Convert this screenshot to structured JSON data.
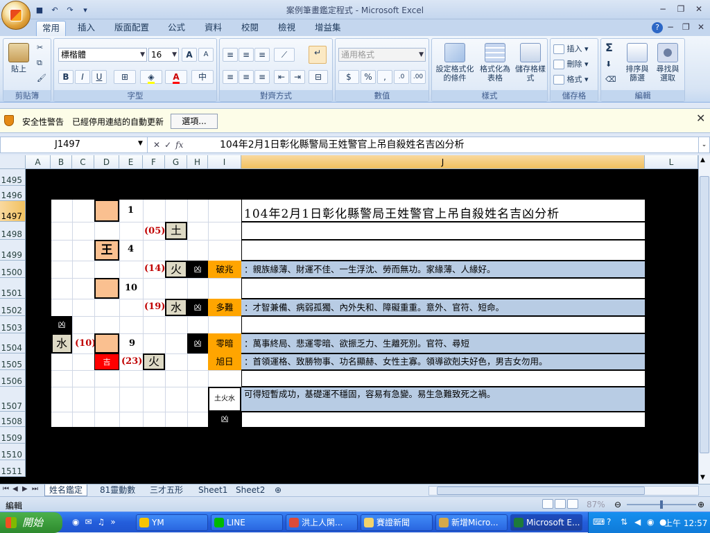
{
  "window": {
    "title": "案例筆畫鑑定程式 - Microsoft Excel",
    "min": "−",
    "restore": "❐",
    "close": "✕"
  },
  "tabs": [
    "常用",
    "插入",
    "版面配置",
    "公式",
    "資料",
    "校閱",
    "檢視",
    "增益集"
  ],
  "ribbon": {
    "clipboard": {
      "paste": "貼上",
      "label": "剪貼簿"
    },
    "font": {
      "name": "標楷體",
      "size": "16",
      "bold": "B",
      "italic": "I",
      "underline": "U",
      "grow": "A",
      "shrink": "A",
      "label": "字型"
    },
    "align": {
      "label": "對齊方式"
    },
    "number": {
      "format": "通用格式",
      "currency": "$",
      "percent": "%",
      "comma": ",",
      "label": "數值"
    },
    "styles": {
      "cond": "設定格式化的條件",
      "table": "格式化為表格",
      "cell": "儲存格樣式",
      "label": "樣式"
    },
    "cells": {
      "insert": "插入",
      "delete": "刪除",
      "format": "格式",
      "label": "儲存格"
    },
    "editing": {
      "sum": "Σ",
      "sort": "排序與篩選",
      "find": "尋找與選取",
      "label": "編輯"
    }
  },
  "security": {
    "title": "安全性警告",
    "message": "已經停用連結的自動更新",
    "options": "選項..."
  },
  "formula_bar": {
    "name_box": "J1497",
    "fx": "fx",
    "content": "104年2月1日彰化縣警局王姓警官上吊自殺姓名吉凶分析"
  },
  "columns": [
    "A",
    "B",
    "C",
    "D",
    "E",
    "F",
    "G",
    "H",
    "I",
    "J",
    "L"
  ],
  "rows": [
    "1495",
    "1496",
    "1497",
    "1498",
    "1499",
    "1500",
    "1501",
    "1502",
    "1503",
    "1504",
    "1505",
    "1506",
    "1507",
    "1508",
    "1509",
    "1510",
    "1511"
  ],
  "analysis": {
    "title": "104年2月1日彰化縣警局王姓警官上吊自殺姓名吉凶分析",
    "num_1": "1",
    "num_4": "4",
    "num_10": "10",
    "num_9": "9",
    "char_wang": "王",
    "gen_05": "(05)",
    "el_05": "土",
    "gen_14": "(14)",
    "el_14": "火",
    "bad_14": "凶",
    "term_14": "破兆",
    "desc_14": "：親族緣薄、財運不佳、一生浮沈、勞而無功。家緣薄、人緣好。",
    "gen_19": "(19)",
    "el_19": "水",
    "bad_19": "凶",
    "term_19": "多難",
    "desc_19": "：才智兼備、病弱孤獨、內外失和、障礙重重。意外、官符、短命。",
    "bad_1503": "凶",
    "el_10": "水",
    "gen_10": "(10)",
    "bad_1504": "凶",
    "term_1504": "零暗",
    "desc_1504": "：萬事終局、悲運零暗、欲振乏力、生離死別。官符、尋短",
    "good_23": "吉",
    "gen_23": "(23)",
    "el_23": "火",
    "term_23": "旭日",
    "desc_23": "：首領運格、致勝物事、功名顯赫、女性主寡。領導欲剋夫好色，男吉女勿用。",
    "sancai": "土火水",
    "sancai_desc": "可得短暫成功，基礎運不穩固，容易有急變。易生急難致死之禍。",
    "bad_sancai": "凶"
  },
  "sheet_tabs": [
    "姓名鑑定",
    "81靈動數",
    "三才五形",
    "Sheet1",
    "Sheet2"
  ],
  "status": {
    "mode": "編輯",
    "zoom": "87%"
  },
  "taskbar": {
    "start": "開始",
    "items": [
      "YM",
      "LINE",
      "洪上人閑...",
      "賽證新聞",
      "新增Micro...",
      "Microsoft E..."
    ],
    "clock": "上午 12:57"
  },
  "colors": {
    "peach": "#fac090",
    "orange": "#ffa500",
    "blue": "#b8cce4",
    "red": "#ff0000",
    "tan": "#ddd9c4"
  }
}
